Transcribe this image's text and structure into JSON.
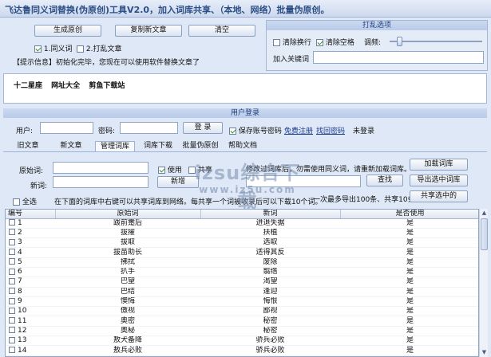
{
  "window": {
    "title": "飞达鲁同义词替换(伪原创)工具V2.0，加入词库共享、（本地、网络）批量伪原创。"
  },
  "toolbar": {
    "generate": "生成原创",
    "copy_new": "复制新文章",
    "clear": "清空",
    "opt_synonym": "1.同义词",
    "opt_shuffle": "2.打乱文章",
    "hint": "【提示信息】初始化完毕，您现在可以使用软件替换文章了"
  },
  "shuffle": {
    "title": "打乱选项",
    "remove_newline": "清除换行",
    "remove_space": "清除空格",
    "adjust": "调频:",
    "slider_level": 0.08,
    "add_keyword": "加入关键词"
  },
  "links_bar": {
    "items": [
      "十二星座",
      "网址大全",
      "剪鱼下载站"
    ]
  },
  "login": {
    "title": "用户登录",
    "user_label": "用户:",
    "password_label": "密码:",
    "login_button": "登 录",
    "save_password": "保存账号密码",
    "free_register": "免费注册",
    "find_password": "找回密码",
    "status": "未登录"
  },
  "tabs": [
    "旧文章",
    "新文章",
    "管理词库",
    "词库下载",
    "批量伪原创",
    "帮助文档"
  ],
  "active_tab": 2,
  "lexicon": {
    "original_label": "原始词:",
    "new_label": "新词:",
    "use_label": "使用",
    "share_label": "共享",
    "notice": "修改过词库后，勿需使用同义词，请重新加载词库。",
    "load_button": "加载词库",
    "add_button": "新增",
    "search_button": "查找",
    "export_button": "导出选中词库",
    "select_all": "全选",
    "share_hint": "在下面的词库中右键可以共享词库到网络。每共享一个词被收录后可以下载10个词。",
    "limit_hint": "一次最多导出100条、共享10条。",
    "share_selected_button": "共享选中的"
  },
  "watermark": {
    "line1": "izsu综合下载",
    "line2": "www.iz5u.com"
  },
  "table": {
    "headers": [
      "编号",
      "原始词",
      "新词",
      "是否使用"
    ],
    "rows": [
      [
        "1",
        "跋前疐后",
        "进退失据",
        "是"
      ],
      [
        "2",
        "拔擢",
        "扶植",
        "是"
      ],
      [
        "3",
        "拔取",
        "选取",
        "是"
      ],
      [
        "4",
        "拔苗助长",
        "适得其反",
        "是"
      ],
      [
        "5",
        "拂拭",
        "废除",
        "是"
      ],
      [
        "6",
        "扒手",
        "翦绺",
        "是"
      ],
      [
        "7",
        "巴望",
        "渴望",
        "是"
      ],
      [
        "8",
        "巴结",
        "逢迎",
        "是"
      ],
      [
        "9",
        "懊悔",
        "悔恨",
        "是"
      ],
      [
        "10",
        "傲视",
        "鄙视",
        "是"
      ],
      [
        "11",
        "奥密",
        "秘密",
        "是"
      ],
      [
        "12",
        "奥秘",
        "秘密",
        "是"
      ],
      [
        "13",
        "敖犬备降",
        "骄兵必败",
        "是"
      ],
      [
        "14",
        "敖兵必败",
        "骄兵必败",
        "是"
      ]
    ]
  }
}
